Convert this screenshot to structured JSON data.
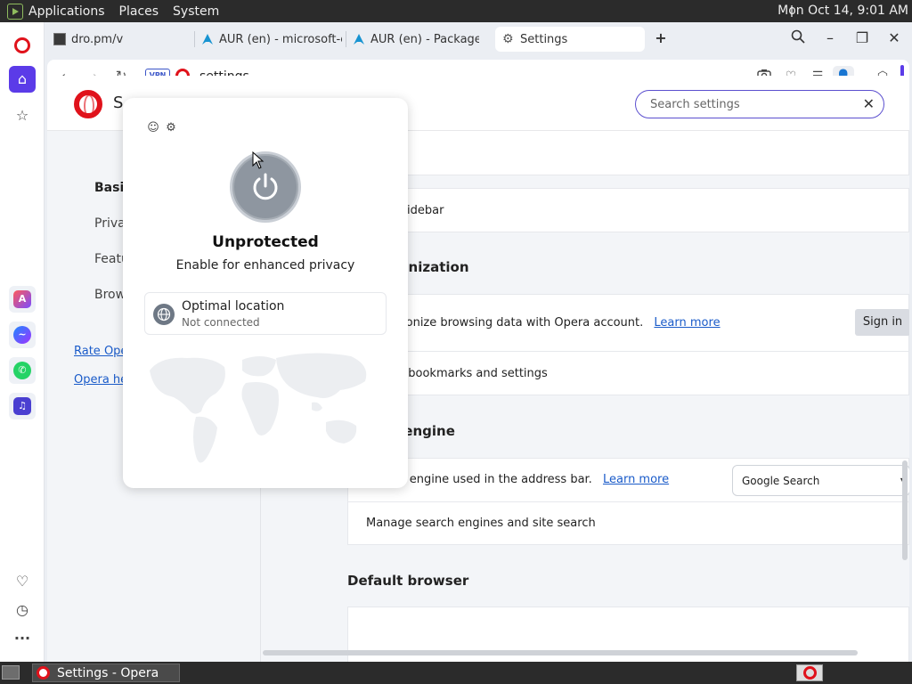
{
  "system": {
    "menus": [
      "Applications",
      "Places",
      "System"
    ],
    "clock": "Mon Oct 14,  9:01 AM"
  },
  "tabs": [
    {
      "label": "dro.pm/v",
      "active": false
    },
    {
      "label": "AUR (en) - microsoft-ed",
      "active": false
    },
    {
      "label": "AUR (en) - Packages",
      "active": false
    },
    {
      "label": "Settings",
      "active": true
    }
  ],
  "address_bar": {
    "vpn_label": "VPN",
    "url": "settings"
  },
  "settings": {
    "header_letter": "S",
    "search_placeholder": "Search settings",
    "nav": {
      "basic": "Basic",
      "privacy": "Privacy",
      "features": "Features",
      "browser": "Browser",
      "rate": "Rate Opera",
      "help": "Opera help"
    },
    "sidebar_row": "Show sidebar",
    "sync_title": "Synchronization",
    "sync_text": "Synchronize browsing data with Opera account.",
    "learn_more": "Learn more",
    "sign_in": "Sign in",
    "import_text": "Import bookmarks and settings",
    "search_engine_title": "Search engine",
    "search_engine_text": "Search engine used in the address bar.",
    "search_engine_value": "Google Search",
    "manage_search": "Manage search engines and site search",
    "default_browser_title": "Default browser"
  },
  "vpn": {
    "status": "Unprotected",
    "subtitle": "Enable for enhanced privacy",
    "location_title": "Optimal location",
    "location_status": "Not connected"
  },
  "taskbar": {
    "window_title": "Settings - Opera"
  },
  "colors": {
    "opera_red": "#e0121b",
    "accent": "#5b3be8",
    "link": "#1a5bc9"
  }
}
